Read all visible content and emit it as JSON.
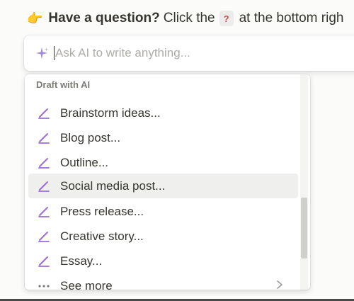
{
  "hint": {
    "emoji": "👉",
    "strong": "Have a question?",
    "prefix": "Click the",
    "help_glyph": "?",
    "suffix": "at the bottom righ"
  },
  "ai_input": {
    "placeholder": "Ask AI to write anything...",
    "value": "",
    "icon": "sparkle-icon"
  },
  "menu": {
    "section_title": "Draft with AI",
    "items": [
      {
        "label": "Brainstorm ideas...",
        "icon": "pencil-icon"
      },
      {
        "label": "Blog post...",
        "icon": "pencil-icon"
      },
      {
        "label": "Outline...",
        "icon": "pencil-icon"
      },
      {
        "label": "Social media post...",
        "icon": "pencil-icon",
        "highlighted": true
      },
      {
        "label": "Press release...",
        "icon": "pencil-icon"
      },
      {
        "label": "Creative story...",
        "icon": "pencil-icon"
      },
      {
        "label": "Essay...",
        "icon": "pencil-icon"
      }
    ],
    "see_more": {
      "label": "See more",
      "icon": "more-dots-icon"
    }
  },
  "colors": {
    "accent_purple": "#9a6dd7",
    "text": "#37352f",
    "muted": "#7d7b77",
    "hover_bg": "#efefee"
  }
}
